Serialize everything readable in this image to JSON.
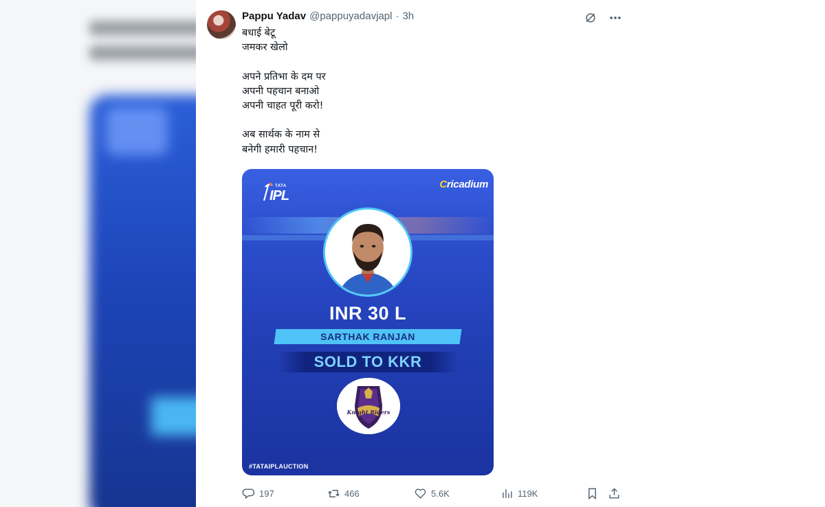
{
  "tweet": {
    "author_name": "Pappu Yadav",
    "author_handle": "@pappuyadavjapl",
    "separator": "·",
    "timestamp": "3h",
    "text_lines": [
      "बधाई बेटू",
      "जमकर खेलो",
      "",
      "अपने प्रतिभा के दम पर",
      "अपनी पहचान बनाओ",
      "अपनी चाहत पूरी करो!",
      "",
      "अब सार्थक के नाम से",
      "बनेगी हमारी पहचान!"
    ]
  },
  "media": {
    "ipl_brand_small": "TATA",
    "ipl_brand": "IPL",
    "sponsor_prefix": "C",
    "sponsor_rest": "ricadium",
    "price": "INR 30 L",
    "player_name": "SARTHAK RANJAN",
    "sold_label": "SOLD TO KKR",
    "team_logo_text": "Knight Riders",
    "hashtag": "#TATAIPLAUCTION"
  },
  "actions": {
    "replies": "197",
    "retweets": "466",
    "likes": "5.6K",
    "views": "119K"
  },
  "icons": {
    "grok": "grok-icon",
    "more": "more-icon",
    "reply": "reply-icon",
    "retweet": "retweet-icon",
    "like": "heart-icon",
    "views": "views-icon",
    "bookmark": "bookmark-icon",
    "share": "share-icon"
  },
  "colors": {
    "text_primary": "#0f1419",
    "text_secondary": "#536471",
    "card_blue": "#223fb6",
    "accent_cyan": "#4fc3f7"
  }
}
